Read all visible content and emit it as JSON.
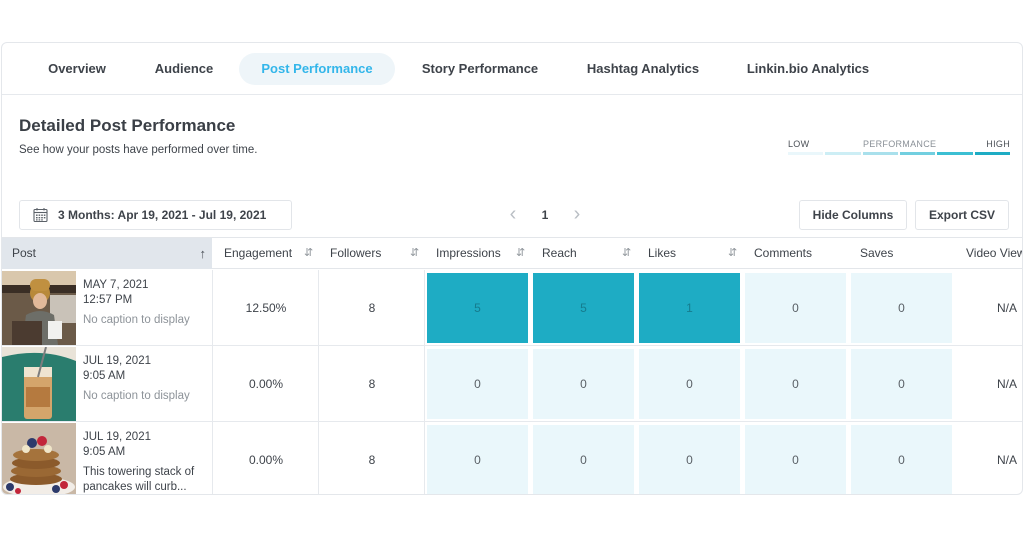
{
  "tabs": [
    {
      "label": "Overview",
      "active": false
    },
    {
      "label": "Audience",
      "active": false
    },
    {
      "label": "Post Performance",
      "active": true
    },
    {
      "label": "Story Performance",
      "active": false
    },
    {
      "label": "Hashtag Analytics",
      "active": false
    },
    {
      "label": "Linkin.bio Analytics",
      "active": false
    }
  ],
  "header": {
    "title": "Detailed Post Performance",
    "subtitle": "See how your posts have performed over time."
  },
  "legend": {
    "low": "LOW",
    "label": "PERFORMANCE",
    "high": "HIGH",
    "scale_colors": [
      "#eaf7fb",
      "#cdeef5",
      "#a9e0ec",
      "#72cfe0",
      "#3cbfd3",
      "#1eacc4"
    ]
  },
  "toolbar": {
    "date_icon": "calendar-icon",
    "date_range": "3 Months: Apr 19, 2021 - Jul 19, 2021",
    "prev_icon": "chevron-left-icon",
    "page": "1",
    "next_icon": "chevron-right-icon",
    "hide_columns": "Hide Columns",
    "export_csv": "Export CSV"
  },
  "colors": {
    "accent": "#33b6ea",
    "heat_high": "#1eacc4",
    "heat_low": "#eaf7fb",
    "post_header_bg": "#e1e6ec"
  },
  "table": {
    "columns": [
      {
        "label": "Post",
        "sort_icon": "arrow-up-icon"
      },
      {
        "label": "Engagement",
        "sort_icon": "sort-icon"
      },
      {
        "label": "Followers",
        "sort_icon": "sort-icon"
      },
      {
        "label": "Impressions",
        "sort_icon": "sort-icon"
      },
      {
        "label": "Reach",
        "sort_icon": "sort-icon"
      },
      {
        "label": "Likes",
        "sort_icon": "sort-icon"
      },
      {
        "label": "Comments",
        "sort_icon": ""
      },
      {
        "label": "Saves",
        "sort_icon": ""
      },
      {
        "label": "Video Views",
        "sort_icon": ""
      }
    ],
    "rows": [
      {
        "thumbnail": "barista-photo",
        "date": "MAY 7, 2021",
        "time": "12:57 PM",
        "caption": "No caption to display",
        "caption_placeholder": true,
        "engagement": "12.50%",
        "followers": "8",
        "impressions": "5",
        "reach": "5",
        "likes": "1",
        "comments": "0",
        "saves": "0",
        "video_views": "N/A"
      },
      {
        "thumbnail": "iced-coffee-photo",
        "date": "JUL 19, 2021",
        "time": "9:05 AM",
        "caption": "No caption to display",
        "caption_placeholder": true,
        "engagement": "0.00%",
        "followers": "8",
        "impressions": "0",
        "reach": "0",
        "likes": "0",
        "comments": "0",
        "saves": "0",
        "video_views": "N/A"
      },
      {
        "thumbnail": "pancakes-photo",
        "date": "JUL 19, 2021",
        "time": "9:05 AM",
        "caption": "This towering stack of pancakes will curb...",
        "caption_placeholder": false,
        "engagement": "0.00%",
        "followers": "8",
        "impressions": "0",
        "reach": "0",
        "likes": "0",
        "comments": "0",
        "saves": "0",
        "video_views": "N/A"
      }
    ]
  }
}
